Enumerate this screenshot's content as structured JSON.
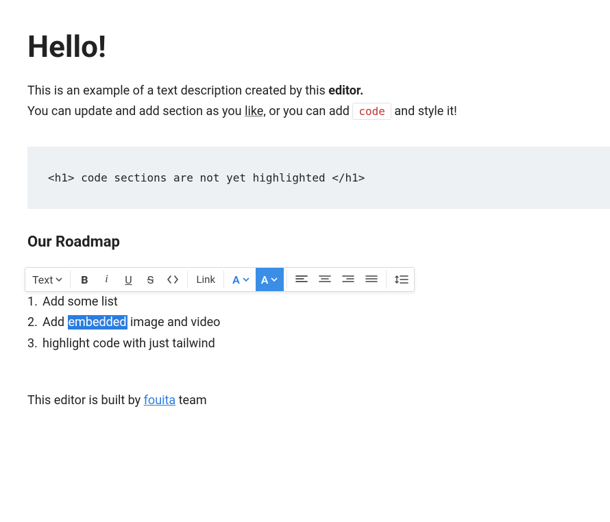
{
  "title": "Hello!",
  "intro": {
    "line1_a": "This is an example of a text description created by this ",
    "line1_b_bold": "editor.",
    "line2_a": "You can update and add section as you ",
    "line2_link": "like,",
    "line2_b": " or you can add ",
    "line2_code": "code",
    "line2_c": " and style it!"
  },
  "code_block": "<h1> code sections are not yet highlighted </h1>",
  "section_heading": "Our Roadmap",
  "toolbar": {
    "text_label": "Text",
    "bold": "B",
    "italic": "i",
    "underline": "U",
    "strike": "S",
    "link": "Link",
    "color_a": "A",
    "highlight_a": "A"
  },
  "list": [
    {
      "n": "1.",
      "before": "Add some list",
      "sel": "",
      "after": ""
    },
    {
      "n": "2.",
      "before": "Add ",
      "sel": "embedded",
      "after": " image and video"
    },
    {
      "n": "3.",
      "before": "highlight code with just tailwind",
      "sel": "",
      "after": ""
    }
  ],
  "footer": {
    "a": "This editor is built by ",
    "link": "fouita",
    "b": " team"
  }
}
